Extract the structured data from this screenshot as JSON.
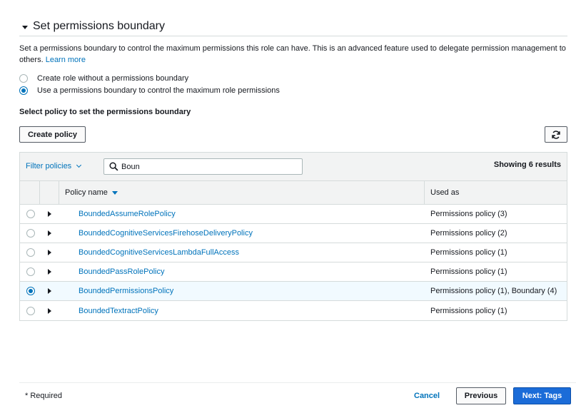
{
  "section": {
    "title": "Set permissions boundary",
    "description": "Set a permissions boundary to control the maximum permissions this role can have. This is an advanced feature used to delegate permission management to others.",
    "learn_more": "Learn more"
  },
  "options": [
    {
      "label": "Create role without a permissions boundary",
      "selected": false
    },
    {
      "label": "Use a permissions boundary to control the maximum role permissions",
      "selected": true
    }
  ],
  "select_policy_label": "Select policy to set the permissions boundary",
  "toolbar": {
    "create_policy": "Create policy",
    "refresh_icon": "refresh-icon"
  },
  "filter": {
    "label": "Filter policies",
    "search_value": "Boun",
    "search_placeholder": "Search",
    "showing": "Showing 6 results"
  },
  "table": {
    "columns": [
      "Policy name",
      "Used as"
    ],
    "sort": "descending",
    "rows": [
      {
        "name": "BoundedAssumeRolePolicy",
        "used_as": "Permissions policy (3)",
        "selected": false
      },
      {
        "name": "BoundedCognitiveServicesFirehoseDeliveryPolicy",
        "used_as": "Permissions policy (2)",
        "selected": false
      },
      {
        "name": "BoundedCognitiveServicesLambdaFullAccess",
        "used_as": "Permissions policy (1)",
        "selected": false
      },
      {
        "name": "BoundedPassRolePolicy",
        "used_as": "Permissions policy (1)",
        "selected": false
      },
      {
        "name": "BoundedPermissionsPolicy",
        "used_as": "Permissions policy (1), Boundary (4)",
        "selected": true
      },
      {
        "name": "BoundedTextractPolicy",
        "used_as": "Permissions policy (1)",
        "selected": false
      }
    ]
  },
  "footer": {
    "required": "* Required",
    "cancel": "Cancel",
    "previous": "Previous",
    "next": "Next: Tags"
  },
  "colors": {
    "link": "#0073bb",
    "primary_button": "#1b6cd8",
    "selected_row": "#f1faff",
    "table_header": "#f2f3f3"
  }
}
